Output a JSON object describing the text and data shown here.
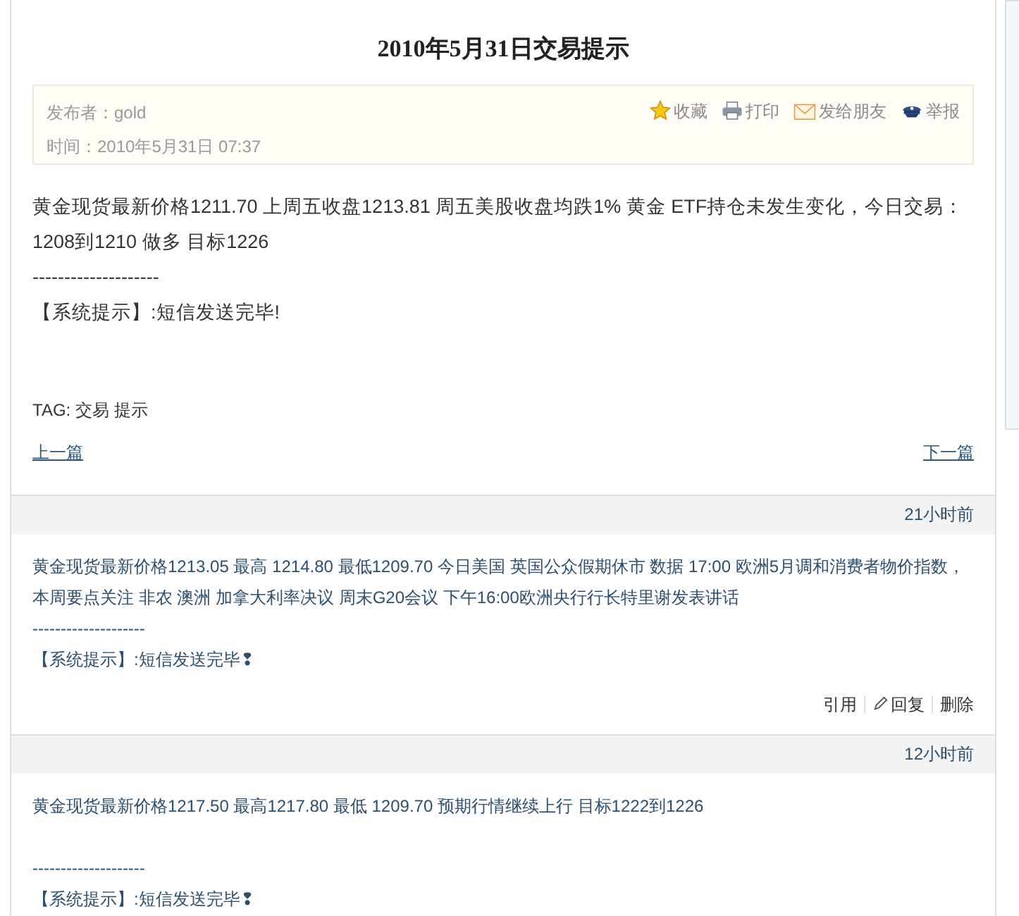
{
  "article": {
    "title": "2010年5月31日交易提示",
    "meta": {
      "author": "发布者：gold",
      "time": "时间：2010年5月31日 07:37",
      "actions": [
        {
          "kind": "star",
          "label": "收藏"
        },
        {
          "kind": "print",
          "label": "打印"
        },
        {
          "kind": "mail",
          "label": "发给朋友"
        },
        {
          "kind": "report",
          "label": "举报"
        }
      ]
    },
    "text": "黄金现货最新价格1211.70  上周五收盘1213.81  周五美股收盘均跌1% 黄金 ETF持仓未发生变化，今日交易：1208到1210  做多  目标1226",
    "separator": "--------------------",
    "notice": "【系统提示】:短信发送完毕!",
    "tags": "TAG: 交易 提示",
    "prev": "上一篇",
    "next": "下一篇"
  },
  "comments": [
    {
      "time": "21小时前",
      "text": "黄金现货最新价格1213.05 最高 1214.80  最低1209.70 今日美国 英国公众假期休市  数据 17:00 欧洲5月调和消费者物价指数，本周要点关注 非农 澳洲 加拿大利率决议 周末G20会议 下午16:00欧洲央行行长特里谢发表讲话",
      "separator": "--------------------",
      "notice": "【系统提示】:短信发送完毕❢",
      "actions": [
        {
          "kind": "plain",
          "label": "引用"
        },
        {
          "kind": "edit",
          "label": "回复"
        },
        {
          "kind": "plain",
          "label": "删除"
        }
      ]
    },
    {
      "time": "12小时前",
      "text": "黄金现货最新价格1217.50 最高1217.80 最低 1209.70 预期行情继续上行 目标1222到1226\n ",
      "separator": "--------------------",
      "notice": "【系统提示】:短信发送完毕❢"
    }
  ]
}
